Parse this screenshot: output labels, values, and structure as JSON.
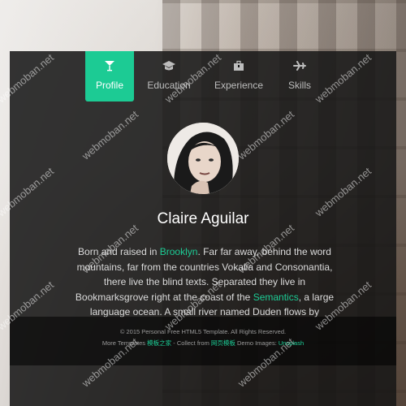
{
  "tabs": [
    {
      "label": "Profile",
      "icon": "cocktail-icon",
      "active": true
    },
    {
      "label": "Education",
      "icon": "graduation-cap-icon",
      "active": false
    },
    {
      "label": "Experience",
      "icon": "briefcase-icon",
      "active": false
    },
    {
      "label": "Skills",
      "icon": "airplane-icon",
      "active": false
    }
  ],
  "profile": {
    "name": "Claire Aguilar",
    "bio_parts": {
      "p1": "Born and raised in ",
      "link1": "Brooklyn",
      "p2": ". Far far away, behind the word mountains, far from the countries Vokalia and Consonantia, there live the blind texts. Separated they live in Bookmarksgrove right at the coast of the ",
      "link2": "Semantics",
      "p3": ", a large language ocean. A small river named Duden flows by"
    }
  },
  "footer": {
    "line1": "© 2015 Personal Free HTML5 Template. All Rights Reserved.",
    "more_templates": "More Templates ",
    "link_a": "模板之家",
    "collect_from": " - Collect from ",
    "link_b": "网页模板",
    "demo_images": " Demo Images: ",
    "link_c": "Unsplash"
  },
  "watermark": "webmoban.net",
  "colors": {
    "accent": "#1ccb94",
    "card": "#141414"
  }
}
